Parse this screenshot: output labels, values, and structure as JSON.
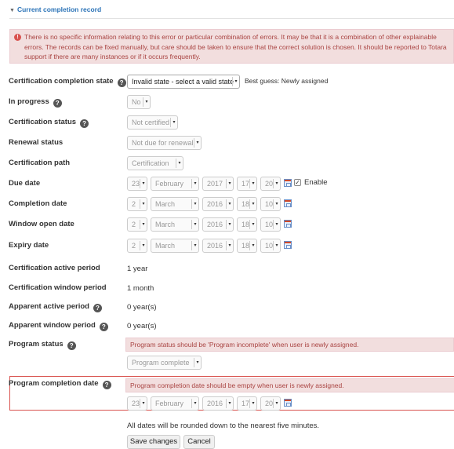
{
  "section": {
    "title": "Current completion record"
  },
  "alert": {
    "text": "There is no specific information relating to this error or particular combination of errors. It may be that it is a combination of other explainable errors. The records can be fixed manually, but care should be taken to ensure that the correct solution is chosen. It should be reported to Totara support if there are many instances or if it occurs frequently."
  },
  "fields": {
    "completion_state": {
      "label": "Certification completion state",
      "value": "Invalid state - select a valid state",
      "hint": "Best guess: Newly assigned"
    },
    "in_progress": {
      "label": "In progress",
      "value": "No"
    },
    "cert_status": {
      "label": "Certification status",
      "value": "Not certified"
    },
    "renewal_status": {
      "label": "Renewal status",
      "value": "Not due for renewal"
    },
    "cert_path": {
      "label": "Certification path",
      "value": "Certification"
    },
    "due_date": {
      "label": "Due date",
      "day": "23",
      "month": "February",
      "year": "2017",
      "hour": "17",
      "minute": "20",
      "enable_label": "Enable"
    },
    "completion_date": {
      "label": "Completion date",
      "day": "2",
      "month": "March",
      "year": "2016",
      "hour": "18",
      "minute": "10"
    },
    "window_open_date": {
      "label": "Window open date",
      "day": "2",
      "month": "March",
      "year": "2016",
      "hour": "18",
      "minute": "10"
    },
    "expiry_date": {
      "label": "Expiry date",
      "day": "2",
      "month": "March",
      "year": "2016",
      "hour": "18",
      "minute": "10"
    },
    "active_period": {
      "label": "Certification active period",
      "value": "1 year"
    },
    "window_period": {
      "label": "Certification window period",
      "value": "1 month"
    },
    "apparent_active": {
      "label": "Apparent active period",
      "value": "0 year(s)"
    },
    "apparent_window": {
      "label": "Apparent window period",
      "value": "0 year(s)"
    },
    "program_status": {
      "label": "Program status",
      "error": "Program status should be 'Program incomplete' when user is newly assigned.",
      "value": "Program complete"
    },
    "program_completion_date": {
      "label": "Program completion date",
      "error": "Program completion date should be empty when user is newly assigned.",
      "day": "23",
      "month": "February",
      "year": "2016",
      "hour": "17",
      "minute": "20"
    }
  },
  "footer": {
    "note": "All dates will be rounded down to the nearest five minutes.",
    "save_label": "Save changes",
    "cancel_label": "Cancel"
  },
  "icons": {
    "help": "help-icon",
    "calendar": "calendar-icon",
    "alert": "alert-icon",
    "caret": "caret-down-icon"
  },
  "colors": {
    "link": "#2b73b7",
    "error_bg": "#f2dede",
    "error_text": "#a94442",
    "error_border": "#d9534f"
  }
}
